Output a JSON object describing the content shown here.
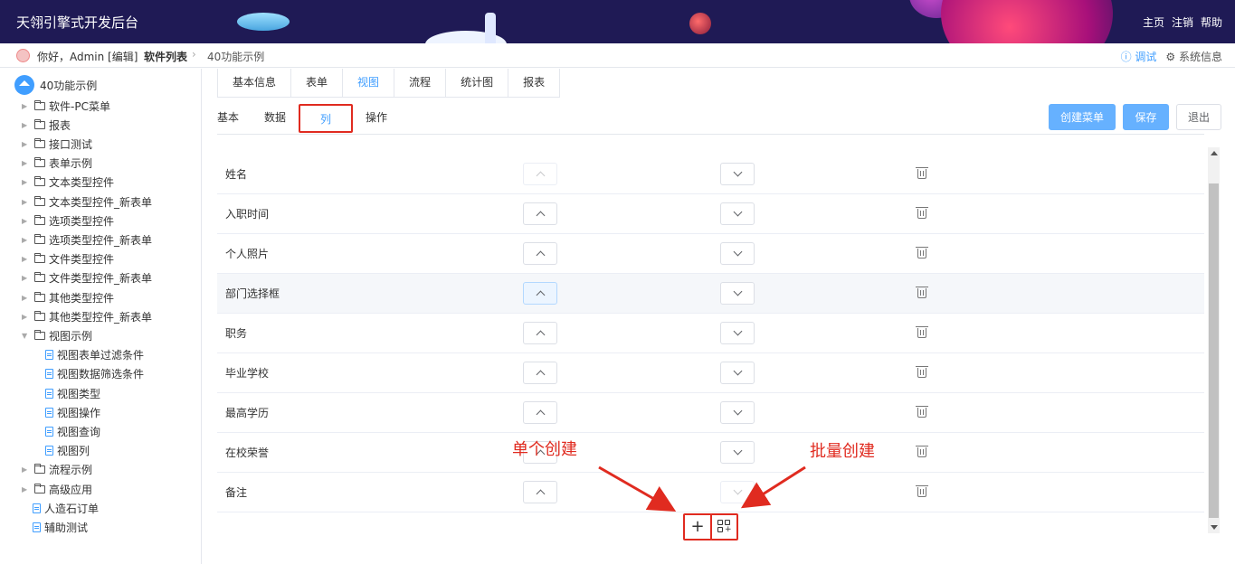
{
  "header": {
    "title": "天翎引擎式开发后台",
    "nav": [
      "主页",
      "注销",
      "帮助"
    ]
  },
  "breadcrumb": {
    "greeting": "你好，Admin [编辑]",
    "level1": "软件列表",
    "level2": "40功能示例",
    "debug_label": "调试",
    "sysinfo_label": "系统信息"
  },
  "sidebar": {
    "root": "40功能示例",
    "items": [
      {
        "label": "软件-PC菜单",
        "type": "folder",
        "expanded": false
      },
      {
        "label": "报表",
        "type": "folder",
        "expanded": false
      },
      {
        "label": "接口测试",
        "type": "folder",
        "expanded": false
      },
      {
        "label": "表单示例",
        "type": "folder",
        "expanded": false
      },
      {
        "label": "文本类型控件",
        "type": "folder",
        "expanded": false
      },
      {
        "label": "文本类型控件_新表单",
        "type": "folder",
        "expanded": false
      },
      {
        "label": "选项类型控件",
        "type": "folder",
        "expanded": false
      },
      {
        "label": "选项类型控件_新表单",
        "type": "folder",
        "expanded": false
      },
      {
        "label": "文件类型控件",
        "type": "folder",
        "expanded": false
      },
      {
        "label": "文件类型控件_新表单",
        "type": "folder",
        "expanded": false
      },
      {
        "label": "其他类型控件",
        "type": "folder",
        "expanded": false
      },
      {
        "label": "其他类型控件_新表单",
        "type": "folder",
        "expanded": false
      },
      {
        "label": "视图示例",
        "type": "folder",
        "expanded": true
      },
      {
        "label": "视图表单过滤条件",
        "type": "file",
        "child": true
      },
      {
        "label": "视图数据筛选条件",
        "type": "file",
        "child": true
      },
      {
        "label": "视图类型",
        "type": "file",
        "child": true
      },
      {
        "label": "视图操作",
        "type": "file",
        "child": true
      },
      {
        "label": "视图查询",
        "type": "file",
        "child": true
      },
      {
        "label": "视图列",
        "type": "file",
        "child": true
      },
      {
        "label": "流程示例",
        "type": "folder",
        "expanded": false
      },
      {
        "label": "高级应用",
        "type": "folder",
        "expanded": false
      },
      {
        "label": "人造石订单",
        "type": "file",
        "child": false
      },
      {
        "label": "辅助测试",
        "type": "file",
        "child": false
      }
    ]
  },
  "tabs": [
    {
      "label": "基本信息",
      "active": false
    },
    {
      "label": "表单",
      "active": false
    },
    {
      "label": "视图",
      "active": true
    },
    {
      "label": "流程",
      "active": false
    },
    {
      "label": "统计图",
      "active": false
    },
    {
      "label": "报表",
      "active": false
    }
  ],
  "subtabs": [
    {
      "label": "基本",
      "active": false
    },
    {
      "label": "数据",
      "active": false
    },
    {
      "label": "列",
      "active": true
    },
    {
      "label": "操作",
      "active": false
    }
  ],
  "buttons": {
    "create_menu": "创建菜单",
    "save": "保存",
    "exit": "退出"
  },
  "columns": [
    {
      "name": "姓名",
      "up_disabled": true,
      "down_disabled": false,
      "highlight": false
    },
    {
      "name": "入职时间",
      "up_disabled": false,
      "down_disabled": false,
      "highlight": false
    },
    {
      "name": "个人照片",
      "up_disabled": false,
      "down_disabled": false,
      "highlight": false
    },
    {
      "name": "部门选择框",
      "up_disabled": false,
      "down_disabled": false,
      "highlight": true
    },
    {
      "name": "职务",
      "up_disabled": false,
      "down_disabled": false,
      "highlight": false
    },
    {
      "name": "毕业学校",
      "up_disabled": false,
      "down_disabled": false,
      "highlight": false
    },
    {
      "name": "最高学历",
      "up_disabled": false,
      "down_disabled": false,
      "highlight": false
    },
    {
      "name": "在校荣誉",
      "up_disabled": false,
      "down_disabled": false,
      "highlight": false
    },
    {
      "name": "备注",
      "up_disabled": false,
      "down_disabled": true,
      "highlight": false
    }
  ],
  "annotations": {
    "single_create": "单个创建",
    "batch_create": "批量创建"
  },
  "colors": {
    "header_bg": "#1f1a55",
    "accent": "#409eff",
    "annotation": "#e02b20"
  }
}
